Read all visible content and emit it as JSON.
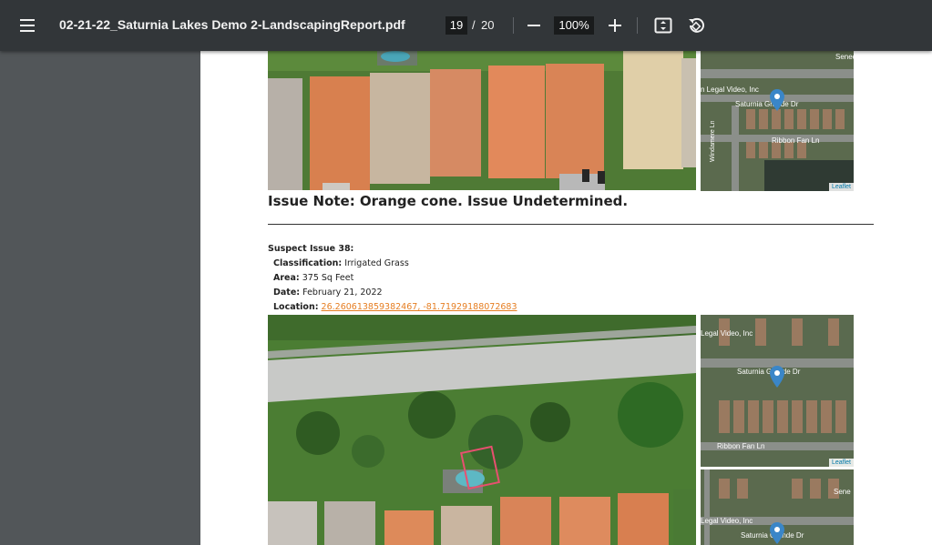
{
  "toolbar": {
    "title": "02-21-22_Saturnia Lakes Demo 2-LandscapingReport.pdf",
    "page_current": "19",
    "page_separator": "/",
    "page_total": "20",
    "zoom": "100%",
    "icons": [
      "menu-icon",
      "zoom-out-icon",
      "zoom-in-icon",
      "fit-page-icon",
      "rotate-icon"
    ]
  },
  "report": {
    "issue_note": "Issue Note: Orange cone. Issue Undetermined.",
    "suspect_title": "Suspect Issue 38:",
    "classification_label": "Classification:",
    "classification_value": "Irrigated Grass",
    "area_label": "Area:",
    "area_value": "375 Sq Feet",
    "date_label": "Date:",
    "date_value": "February 21, 2022",
    "location_label": "Location:",
    "location_value": "26.260613859382467, -81.71929188072683"
  },
  "maps": {
    "attribution": "Leaflet",
    "labels": {
      "seneca": "Senec",
      "legal_video_top": "n Legal Video, Inc",
      "saturnia_top": "Saturnia Grande Dr",
      "ribbon_fan_top": "Ribbon Fan Ln",
      "windamere": "Windamere Ln",
      "legal_video_mid": "Legal Video, Inc",
      "saturnia_mid": "Saturnia Grande Dr",
      "ribbon_fan_mid": "Ribbon Fan Ln",
      "legal_video_bottom": "Legal Video, Inc",
      "saturnia_bottom": "Saturnia Grande Dr",
      "seneca_bottom": "Sene"
    }
  },
  "colors": {
    "toolbar": "#323639",
    "sidebar": "#525659",
    "link": "#e67e22",
    "pin": "#3a86c8"
  }
}
